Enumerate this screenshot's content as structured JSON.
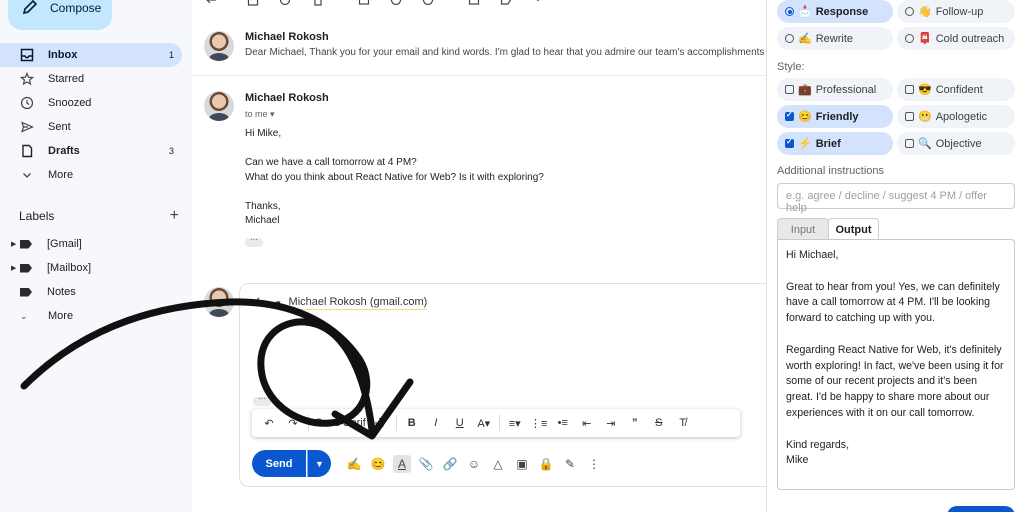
{
  "sidebar": {
    "compose_label": "Compose",
    "items": [
      {
        "label": "Inbox",
        "count": "1",
        "icon": "inbox-icon"
      },
      {
        "label": "Starred",
        "count": "",
        "icon": "star-icon"
      },
      {
        "label": "Snoozed",
        "count": "",
        "icon": "clock-icon"
      },
      {
        "label": "Sent",
        "count": "",
        "icon": "send-icon"
      },
      {
        "label": "Drafts",
        "count": "3",
        "icon": "draft-icon"
      },
      {
        "label": "More",
        "count": "",
        "icon": "chevron-down-icon"
      }
    ],
    "labels_heading": "Labels",
    "labels": [
      {
        "label": "[Gmail]"
      },
      {
        "label": "[Mailbox]"
      },
      {
        "label": "Notes"
      },
      {
        "label": "More"
      }
    ]
  },
  "thread": {
    "msg1": {
      "sender": "Michael Rokosh",
      "preview": "Dear Michael, Thank you for your email and kind words. I'm glad to hear that you admire our team's accomplishments, an"
    },
    "msg2": {
      "sender": "Michael Rokosh",
      "to": "to me",
      "greeting": "Hi Mike,",
      "line1": "Can we have a call tomorrow at 4 PM?",
      "line2": "What do you think about React Native for Web? Is it with exploring?",
      "signoff": "Thanks,",
      "signature": "Michael"
    },
    "reply": {
      "recipient": "Michael Rokosh (gmail.com)",
      "font": "Sans Serif",
      "send_label": "Send"
    }
  },
  "panel": {
    "modes": [
      {
        "label": "Response",
        "emoji": "📩",
        "selected": true
      },
      {
        "label": "Follow-up",
        "emoji": "👋",
        "selected": false
      },
      {
        "label": "Rewrite",
        "emoji": "✍️",
        "selected": false
      },
      {
        "label": "Cold outreach",
        "emoji": "📮",
        "selected": false
      }
    ],
    "style_label": "Style:",
    "styles": [
      {
        "label": "Professional",
        "emoji": "💼",
        "checked": false
      },
      {
        "label": "Confident",
        "emoji": "😎",
        "checked": false
      },
      {
        "label": "Friendly",
        "emoji": "😊",
        "checked": true
      },
      {
        "label": "Apologetic",
        "emoji": "😬",
        "checked": false
      },
      {
        "label": "Brief",
        "emoji": "⚡",
        "checked": true
      },
      {
        "label": "Objective",
        "emoji": "🔍",
        "checked": false
      }
    ],
    "instructions_label": "Additional instructions",
    "instructions_placeholder": "e.g. agree / decline / suggest 4 PM / offer help",
    "tabs": [
      "Input",
      "Output"
    ],
    "active_tab": "Output",
    "output_text": "Hi Michael,\n\nGreat to hear from you! Yes, we can definitely have a call tomorrow at 4 PM. I'll be looking forward to catching up with you.\n\nRegarding React Native for Web, it's definitely worth exploring! In fact, we've been using it for some of our recent projects and it's been great. I'd be happy to share more about our experiences with it on our call tomorrow.\n\nKind regards,\nMike"
  },
  "colors": {
    "accent": "#0b57d0",
    "nav_active": "#d3e3fd",
    "compose_bg": "#c2e7ff"
  }
}
